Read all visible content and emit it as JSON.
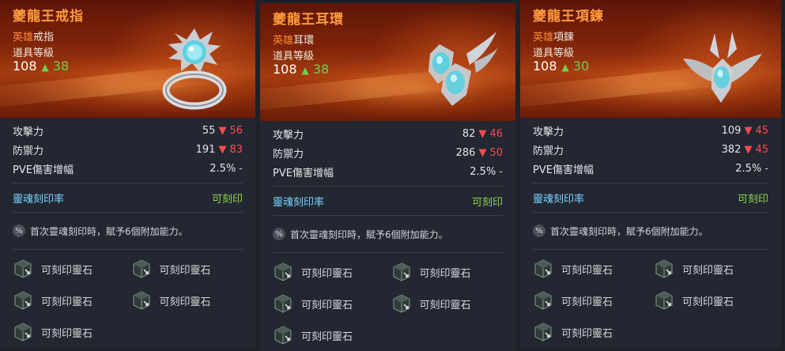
{
  "cards": [
    {
      "name": "夔龍王戒指",
      "grade": "英雄",
      "type": "戒指",
      "item_level_label": "道具等級",
      "item_level": "108",
      "item_level_up": "38",
      "stats": [
        {
          "label": "攻擊力",
          "value": "55",
          "diff": "56"
        },
        {
          "label": "防禦力",
          "value": "191",
          "diff": "83"
        },
        {
          "label": "PVE傷害增幅",
          "value": "2.5%",
          "diff": "-"
        }
      ],
      "soul_label": "靈魂刻印率",
      "soul_value": "可刻印",
      "note": "首次靈魂刻印時，賦予6個附加能力。",
      "slots": [
        "可刻印靈石",
        "可刻印靈石",
        "可刻印靈石",
        "可刻印靈石",
        "可刻印靈石"
      ],
      "art": "ring-icon"
    },
    {
      "name": "夔龍王耳環",
      "grade": "英雄",
      "type": "耳環",
      "item_level_label": "道具等級",
      "item_level": "108",
      "item_level_up": "38",
      "stats": [
        {
          "label": "攻擊力",
          "value": "82",
          "diff": "46"
        },
        {
          "label": "防禦力",
          "value": "286",
          "diff": "50"
        },
        {
          "label": "PVE傷害增幅",
          "value": "2.5%",
          "diff": "-"
        }
      ],
      "soul_label": "靈魂刻印率",
      "soul_value": "可刻印",
      "note": "首次靈魂刻印時，賦予6個附加能力。",
      "slots": [
        "可刻印靈石",
        "可刻印靈石",
        "可刻印靈石",
        "可刻印靈石",
        "可刻印靈石"
      ],
      "art": "earring-icon"
    },
    {
      "name": "夔龍王項鍊",
      "grade": "英雄",
      "type": "項鍊",
      "item_level_label": "道具等級",
      "item_level": "108",
      "item_level_up": "30",
      "stats": [
        {
          "label": "攻擊力",
          "value": "109",
          "diff": "45"
        },
        {
          "label": "防禦力",
          "value": "382",
          "diff": "45"
        },
        {
          "label": "PVE傷害增幅",
          "value": "2.5%",
          "diff": "-"
        }
      ],
      "soul_label": "靈魂刻印率",
      "soul_value": "可刻印",
      "note": "首次靈魂刻印時，賦予6個附加能力。",
      "slots": [
        "可刻印靈石",
        "可刻印靈石",
        "可刻印靈石",
        "可刻印靈石",
        "可刻印靈石"
      ],
      "art": "necklace-icon"
    }
  ],
  "colors": {
    "name": "#ff9a3d",
    "up": "#6fd14e",
    "down": "#ff4c4c",
    "soul_label": "#7ad4ff",
    "soul_value": "#8fd44a"
  }
}
